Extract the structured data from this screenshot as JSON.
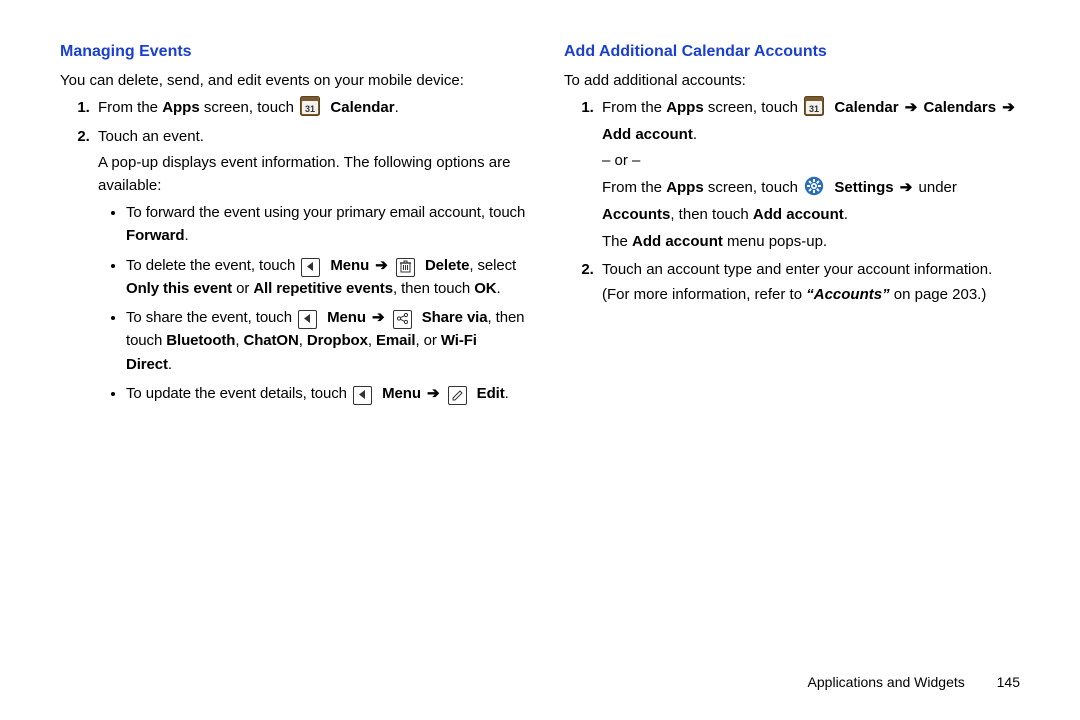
{
  "left": {
    "heading": "Managing Events",
    "intro": "You can delete, send, and edit events on your mobile device:",
    "step1a": "From the ",
    "apps": "Apps",
    "step1b": " screen, touch ",
    "calendar": "Calendar",
    "step2": "Touch an event.",
    "popup": "A pop-up displays event information. The following options are available:",
    "b1": "To forward the event using your primary email account, touch ",
    "forward": "Forward",
    "b2a": "To delete the event, touch ",
    "menu": "Menu",
    "delete": "Delete",
    "b2b": ", select ",
    "only": "Only this event",
    "or": " or ",
    "all": "All repetitive events",
    "thentouch": ", then touch ",
    "ok": "OK",
    "b3a": "To share the event, touch ",
    "sharevia": "Share via",
    "b3b": ", then touch ",
    "bt": "Bluetooth",
    "chaton": "ChatON",
    "dropbox": "Dropbox",
    "email": "Email",
    "orWord": ", or ",
    "wifi": "Wi-Fi Direct",
    "b4": "To update the event details, touch ",
    "edit": "Edit"
  },
  "right": {
    "heading": "Add Additional Calendar Accounts",
    "intro": "To add additional accounts:",
    "step1a": "From the ",
    "apps": "Apps",
    "step1b": " screen, touch ",
    "calendar": "Calendar",
    "calendars": "Calendars",
    "addacct": "Add account",
    "or": "– or –",
    "alt1a": "From the ",
    "alt1b": " screen, touch ",
    "settings": "Settings",
    "under": " under ",
    "accounts": "Accounts",
    "thentouch": ", then touch ",
    "popsup_a": "The ",
    "popsup_b": " menu pops-up.",
    "step2": "Touch an account type and enter your account information.",
    "more_a": "(For more information, refer to ",
    "ref": "“Accounts”",
    "more_b": " on page 203.)"
  },
  "footer": {
    "section": "Applications and Widgets",
    "page": "145"
  },
  "arrow": "➔"
}
